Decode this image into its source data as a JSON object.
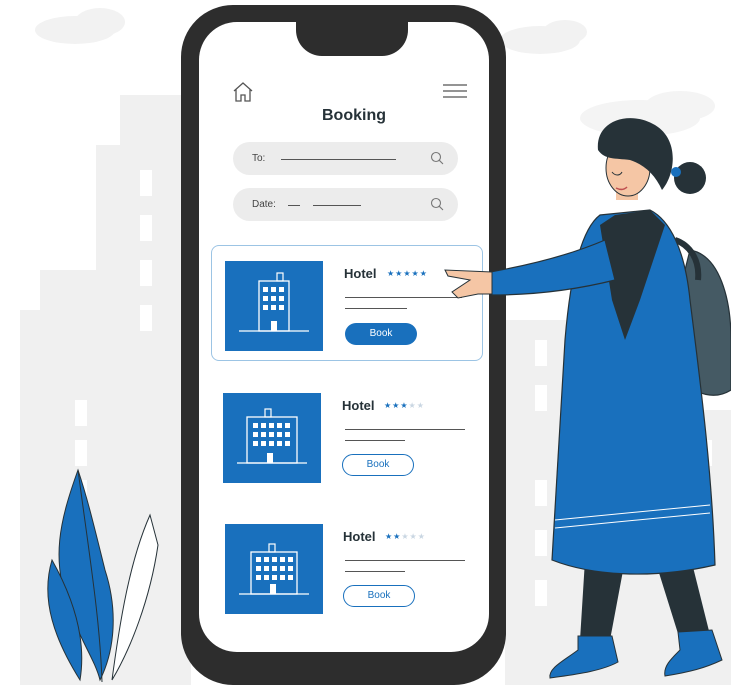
{
  "header": {
    "title": "Booking"
  },
  "search": {
    "to_label": "To:",
    "date_label": "Date:"
  },
  "hotels": [
    {
      "name": "Hotel",
      "stars_on": "★★★★★",
      "stars_off": "",
      "rating": 5,
      "book_label": "Book"
    },
    {
      "name": "Hotel",
      "stars_on": "★★★",
      "stars_off": "★★",
      "rating": 3,
      "book_label": "Book"
    },
    {
      "name": "Hotel",
      "stars_on": "★★",
      "stars_off": "★★★",
      "rating": 2,
      "book_label": "Book"
    }
  ],
  "colors": {
    "accent": "#1970bd",
    "phone_frame": "#2d2d2d",
    "pill_bg": "#ececec",
    "background_buildings": "#f0f0f0"
  },
  "icons": [
    "home-icon",
    "hamburger-menu-icon",
    "search-icon",
    "hotel-building-icon"
  ]
}
